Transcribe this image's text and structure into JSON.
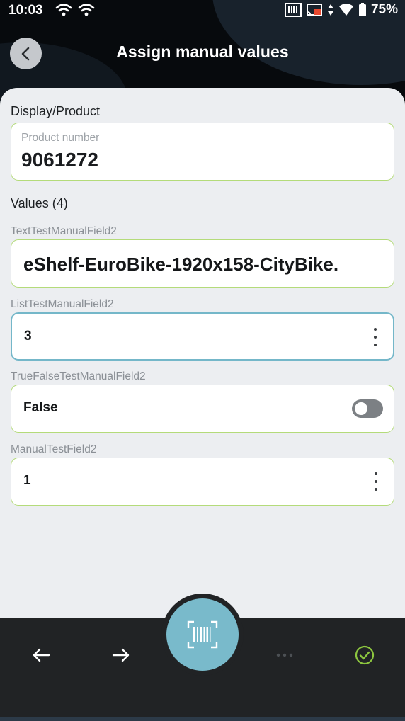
{
  "status_bar": {
    "time": "10:03",
    "battery": "75%",
    "icons_left": [
      "wifi-icon",
      "wifi-icon"
    ],
    "icons_right": [
      "barcode-icon",
      "cast-icon",
      "data-arrows-icon",
      "wifi-signal-icon",
      "battery-icon"
    ]
  },
  "header": {
    "title": "Assign manual values",
    "back_icon": "chevron-left-icon"
  },
  "display_section": {
    "label": "Display/Product",
    "product_field": {
      "label": "Product number",
      "value": "9061272"
    }
  },
  "values_section": {
    "label": "Values (4)",
    "fields": [
      {
        "caption": "TextTestManualField2",
        "value": "eShelf-EuroBike-1920x158-CityBike.",
        "kind": "text"
      },
      {
        "caption": "ListTestManualField2",
        "value": "3",
        "kind": "list"
      },
      {
        "caption": "TrueFalseTestManualField2",
        "value": "False",
        "kind": "toggle",
        "on": false
      },
      {
        "caption": "ManualTestField2",
        "value": "1",
        "kind": "list"
      }
    ]
  },
  "bottom_nav": {
    "items": [
      "arrow-left-icon",
      "arrow-right-icon",
      "barcode-scan-icon",
      "more-horizontal-icon",
      "check-circle-icon"
    ]
  },
  "colors": {
    "accent_border": "#b4db7a",
    "focus_border": "#74b7c9",
    "scan_button": "#79bacb",
    "check": "#8dc63f",
    "bottom_bar": "#212325"
  }
}
